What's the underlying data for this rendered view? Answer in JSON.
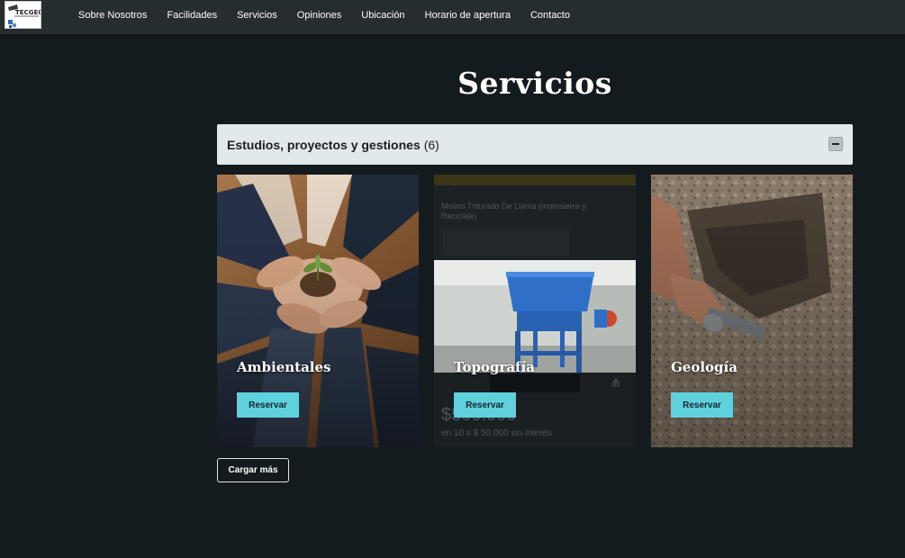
{
  "navbar": {
    "logo_text": "TECGEO",
    "links": [
      {
        "label": "Sobre Nosotros"
      },
      {
        "label": "Facilidades"
      },
      {
        "label": "Servicios"
      },
      {
        "label": "Opiniones"
      },
      {
        "label": "Ubicación"
      },
      {
        "label": "Horario de apertura"
      },
      {
        "label": "Contacto"
      }
    ]
  },
  "page": {
    "title": "Servicios"
  },
  "accordion": {
    "title": "Estudios, proyectos y gestiones",
    "count": "(6)",
    "toggle_icon": "minus-icon"
  },
  "cards": [
    {
      "title": "Ambientales",
      "button": "Reservar",
      "image": "hands-holding-seedling-photo"
    },
    {
      "title": "Topografía",
      "button": "Reservar",
      "image": "blue-machine-photo",
      "background": {
        "heading": "Molino Triturado De Llanta (motosierra y Reciclaje)",
        "price": "$500.000",
        "installments": "en 10 x $ 50.000 sin interés"
      }
    },
    {
      "title": "Geología",
      "button": "Reservar",
      "image": "soil-excavation-photo"
    }
  ],
  "load_more": {
    "label": "Cargar más"
  },
  "colors": {
    "background": "#141b1e",
    "navbar": "#252d31",
    "accent": "#5fd1dd",
    "accordion": "#e2e9eb"
  }
}
